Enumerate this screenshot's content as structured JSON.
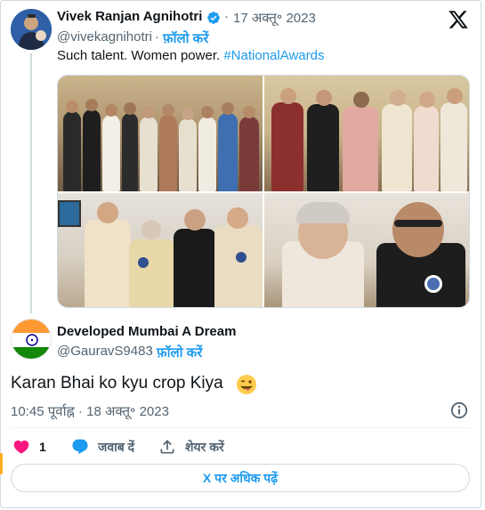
{
  "quoted_tweet": {
    "author_name": "Vivek Ranjan Agnihotri",
    "date": "17 अक्तू॰ 2023",
    "separator": "·",
    "handle": "@vivekagnihotri",
    "follow_label": "फ़ॉलो करें",
    "text": "Such talent. Women power. ",
    "hashtag": "#NationalAwards",
    "photos": [
      "photo-1",
      "photo-2",
      "photo-3",
      "photo-4"
    ]
  },
  "reply_tweet": {
    "author_name": "Developed Mumbai A Dream",
    "handle": "@GauravS9483",
    "separator": "·",
    "follow_label": "फ़ॉलो करें",
    "text": "Karan Bhai ko kyu crop Kiya",
    "emoji": "winking-face-with-tongue",
    "timestamp": "10:45 पूर्वाह्न · 18 अक्तू॰ 2023"
  },
  "actions": {
    "like_count": "1",
    "reply_label": "जवाब दें",
    "share_label": "शेयर करें",
    "read_more_label": "X पर अधिक पढ़ें"
  },
  "colors": {
    "accent": "#1d9bf0",
    "like": "#f91880",
    "muted": "#536471",
    "text": "#0f1419",
    "border": "#cfd9de",
    "verified": "#1d9bf0"
  },
  "icons": [
    "x-logo-icon",
    "verified-badge-icon",
    "info-icon",
    "heart-icon",
    "reply-bubble-icon",
    "share-icon",
    "india-flag-icon"
  ]
}
